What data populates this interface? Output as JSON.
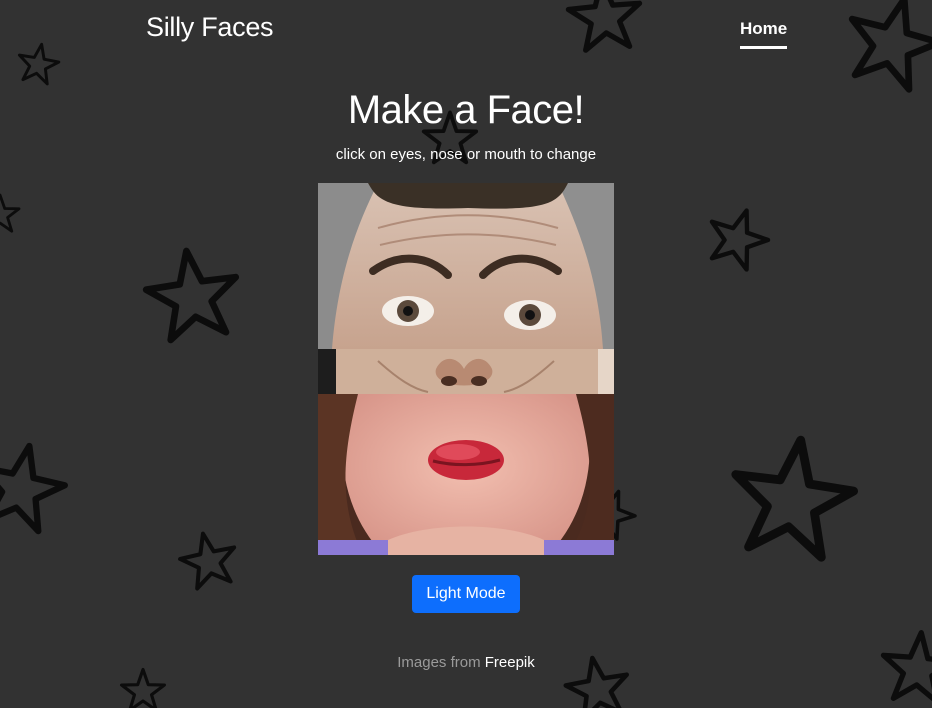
{
  "navbar": {
    "brand": "Silly Faces",
    "home_label": "Home"
  },
  "main": {
    "title": "Make a Face!",
    "subtitle": "click on eyes, nose or mouth to change",
    "mode_button": "Light Mode"
  },
  "footer": {
    "prefix": "Images from",
    "link": "Freepik"
  },
  "colors": {
    "background": "#323232",
    "stars": "#0c0c0c",
    "button": "#0d6efd",
    "muted_text": "#9a9a9a"
  }
}
